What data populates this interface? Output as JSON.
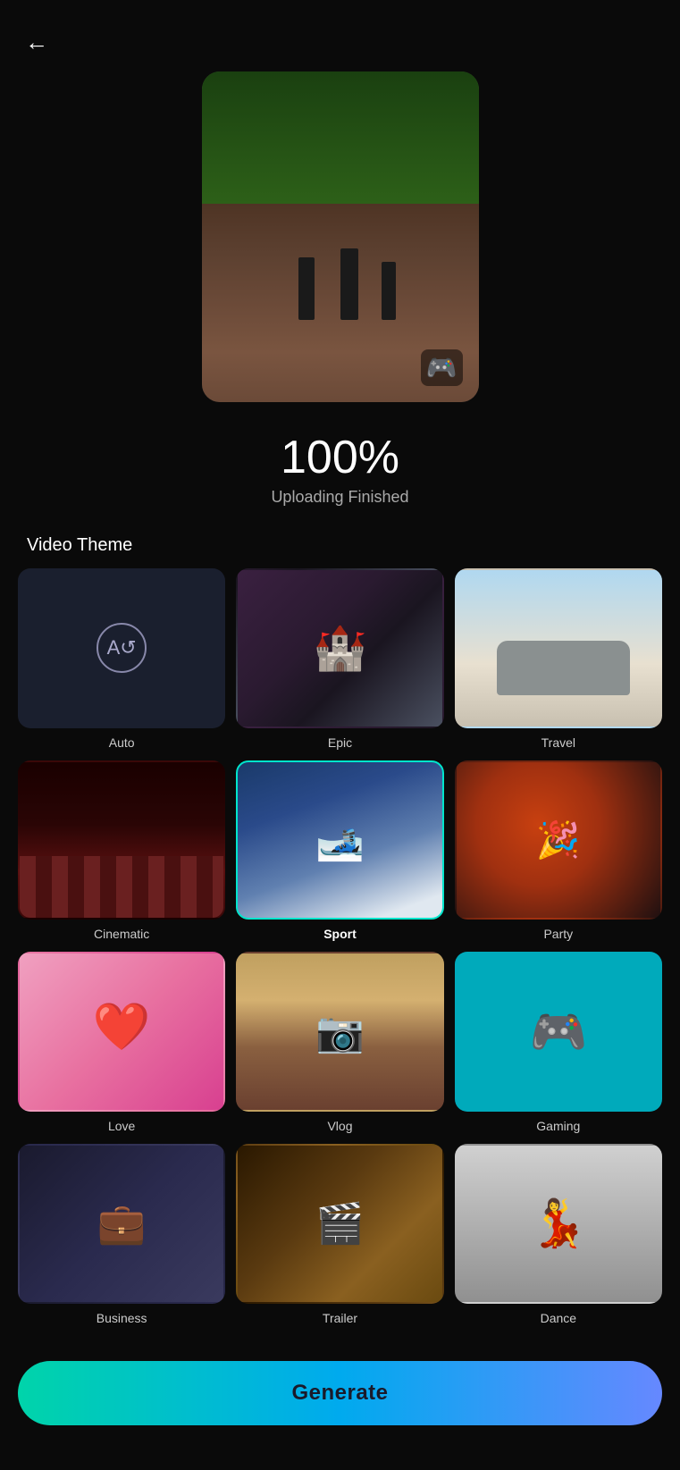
{
  "app": {
    "back_label": "←"
  },
  "preview": {
    "alt": "Uploaded video preview"
  },
  "upload": {
    "percent": "100%",
    "status": "Uploading Finished"
  },
  "video_theme": {
    "section_title": "Video Theme",
    "themes": [
      {
        "id": "auto",
        "label": "Auto",
        "selected": false
      },
      {
        "id": "epic",
        "label": "Epic",
        "selected": false
      },
      {
        "id": "travel",
        "label": "Travel",
        "selected": false
      },
      {
        "id": "cinematic",
        "label": "Cinematic",
        "selected": false
      },
      {
        "id": "sport",
        "label": "Sport",
        "selected": true
      },
      {
        "id": "party",
        "label": "Party",
        "selected": false
      },
      {
        "id": "love",
        "label": "Love",
        "selected": false
      },
      {
        "id": "vlog",
        "label": "Vlog",
        "selected": false
      },
      {
        "id": "gaming",
        "label": "Gaming",
        "selected": false
      },
      {
        "id": "business",
        "label": "Business",
        "selected": false
      },
      {
        "id": "trailer",
        "label": "Trailer",
        "selected": false
      },
      {
        "id": "dance",
        "label": "Dance",
        "selected": false
      }
    ]
  },
  "generate": {
    "button_label": "Generate"
  }
}
